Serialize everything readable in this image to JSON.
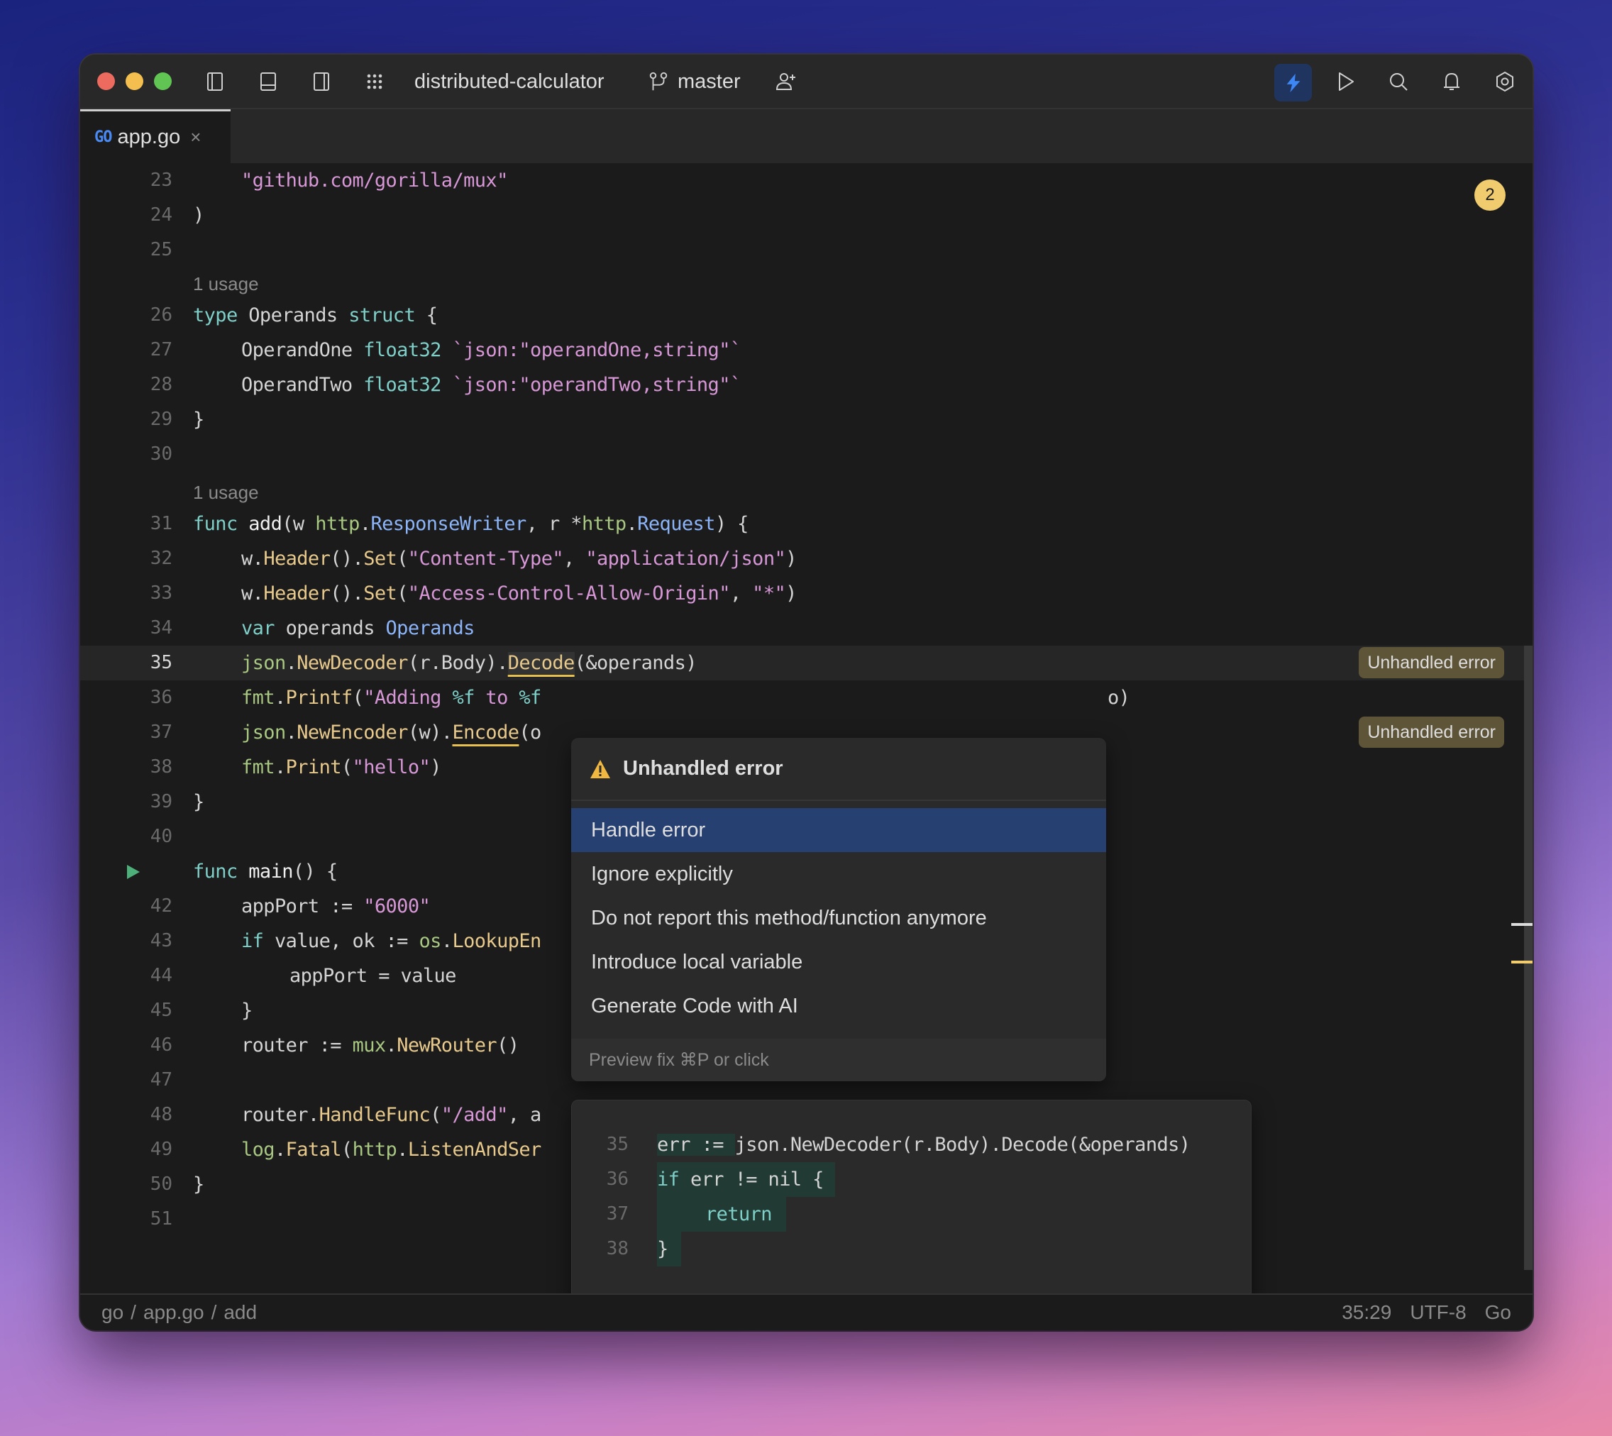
{
  "window": {
    "project_name": "distributed-calculator",
    "branch": "master"
  },
  "toolbar": {
    "left_icons": [
      "sidebar-left-icon",
      "panel-bottom-icon",
      "sidebar-right-icon",
      "grid-menu-icon"
    ],
    "right_icons": [
      "ai-assistant-icon",
      "run-icon",
      "search-icon",
      "bell-icon",
      "settings-icon"
    ],
    "accent_color": "#3d86f5"
  },
  "tab": {
    "badge": "GO",
    "label": "app.go",
    "close": "×"
  },
  "editor": {
    "problems_count": "2",
    "usage_hint": "1 usage",
    "lines": {
      "l23": "23",
      "l24": "24",
      "l25": "25",
      "l26": "26",
      "l27": "27",
      "l28": "28",
      "l29": "29",
      "l30": "30",
      "l31": "31",
      "l32": "32",
      "l33": "33",
      "l34": "34",
      "l35": "35",
      "l36": "36",
      "l37": "37",
      "l38": "38",
      "l39": "39",
      "l40": "40",
      "l42": "42",
      "l43": "43",
      "l44": "44",
      "l45": "45",
      "l46": "46",
      "l47": "47",
      "l48": "48",
      "l49": "49",
      "l50": "50",
      "l51": "51"
    },
    "code": {
      "c23": "\"github.com/gorilla/mux\"",
      "c24": ")",
      "c26_kw": "type",
      "c26_name": " Operands ",
      "c26_kw2": "struct",
      "c26_end": " {",
      "c27_field": "OperandOne ",
      "c27_type": "float32",
      "c27_tag": " `json:\"operandOne,string\"`",
      "c28_field": "OperandTwo ",
      "c28_type": "float32",
      "c28_tag": " `json:\"operandTwo,string\"`",
      "c29": "}",
      "c31_kw": "func",
      "c31_name": " add",
      "c31_p1": "(w ",
      "c31_pkg1": "http",
      "c31_dot1": ".",
      "c31_t1": "ResponseWriter",
      "c31_p2": ", r *",
      "c31_pkg2": "http",
      "c31_dot2": ".",
      "c31_t2": "Request",
      "c31_end": ") {",
      "c32_a": "w.",
      "c32_f1": "Header",
      "c32_b": "().",
      "c32_f2": "Set",
      "c32_c": "(",
      "c32_s1": "\"Content-Type\"",
      "c32_d": ", ",
      "c32_s2": "\"application/json\"",
      "c32_e": ")",
      "c33_a": "w.",
      "c33_f1": "Header",
      "c33_b": "().",
      "c33_f2": "Set",
      "c33_c": "(",
      "c33_s1": "\"Access-Control-Allow-Origin\"",
      "c33_d": ", ",
      "c33_s2": "\"*\"",
      "c33_e": ")",
      "c34_kw": "var",
      "c34_mid": " operands ",
      "c34_t": "Operands",
      "c35_pkg": "json",
      "c35_a": ".",
      "c35_f1": "NewDecoder",
      "c35_b": "(r.Body).",
      "c35_f2": "Decode",
      "c35_c": "(&operands)",
      "c36_pkg": "fmt",
      "c36_a": ".",
      "c36_f": "Printf",
      "c36_b": "(",
      "c36_s1": "\"Adding ",
      "c36_fmt1": "%f",
      "c36_s2": " to ",
      "c36_fmt2": "%f",
      "c36_tail": "o)",
      "c37_pkg": "json",
      "c37_a": ".",
      "c37_f1": "NewEncoder",
      "c37_b": "(w).",
      "c37_f2": "Encode",
      "c37_c": "(o",
      "c38_pkg": "fmt",
      "c38_a": ".",
      "c38_f": "Print",
      "c38_b": "(",
      "c38_s": "\"hello\"",
      "c38_c": ")",
      "c39": "}",
      "c41_kw": "func",
      "c41_name": " main",
      "c41_end": "() {",
      "c42_a": "appPort := ",
      "c42_s": "\"6000\"",
      "c43_kw": "if",
      "c43_a": " value, ok := ",
      "c43_pkg": "os",
      "c43_dot": ".",
      "c43_f": "LookupEn",
      "c44": "appPort = value",
      "c45": "}",
      "c46_a": "router := ",
      "c46_pkg": "mux",
      "c46_dot": ".",
      "c46_f": "NewRouter",
      "c46_b": "()",
      "c48_a": "router.",
      "c48_f": "HandleFunc",
      "c48_b": "(",
      "c48_s": "\"/add\"",
      "c48_c": ", a",
      "c49_pkg": "log",
      "c49_dot": ".",
      "c49_f": "Fatal",
      "c49_b": "(",
      "c49_pkg2": "http",
      "c49_dot2": ".",
      "c49_f2": "ListenAndSer",
      "c50": "}"
    },
    "inlay_hints": [
      "Unhandled error",
      "Unhandled error"
    ]
  },
  "quickfix_popup": {
    "title": "Unhandled error",
    "items": [
      {
        "label": "Handle error",
        "selected": true
      },
      {
        "label": "Ignore explicitly",
        "selected": false
      },
      {
        "label": "Do not report this method/function anymore",
        "selected": false
      },
      {
        "label": "Introduce local variable",
        "selected": false
      },
      {
        "label": "Generate Code with AI",
        "selected": false
      }
    ],
    "footer": "Preview fix ⌘P or click"
  },
  "preview": {
    "lines": [
      {
        "num": "35",
        "added": "err := ",
        "rest": "json.NewDecoder(r.Body).Decode(&operands)"
      },
      {
        "num": "36",
        "kw": "if",
        "added": " err != nil {"
      },
      {
        "num": "37",
        "kw": "return"
      },
      {
        "num": "38",
        "added": "}"
      }
    ]
  },
  "statusbar": {
    "breadcrumb": [
      "go",
      "app.go",
      "add"
    ],
    "separator": "/",
    "position": "35:29",
    "encoding": "UTF-8",
    "language": "Go"
  }
}
